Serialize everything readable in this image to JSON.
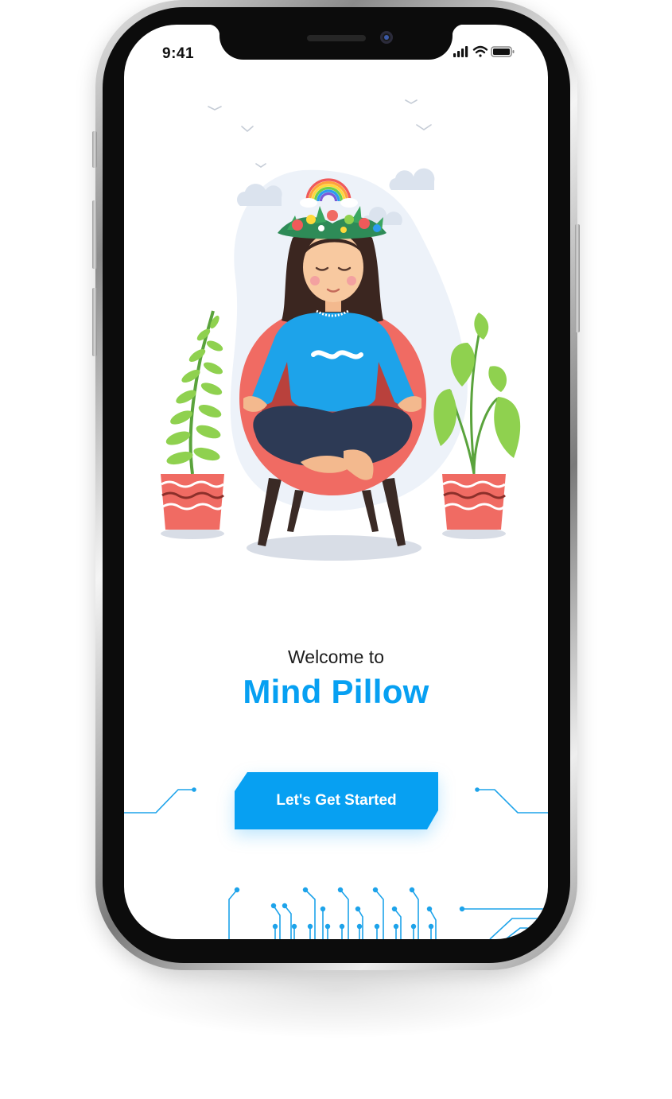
{
  "status_bar": {
    "time": "9:41"
  },
  "welcome": {
    "line1": "Welcome to",
    "app_name": "Mind Pillow"
  },
  "cta": {
    "label": "Let's Get Started"
  },
  "colors": {
    "accent": "#07a0f2",
    "background": "#ffffff",
    "text": "#1c1c1c"
  },
  "icons": [
    "cellular-signal-icon",
    "wifi-icon",
    "battery-icon",
    "meditation-illustration"
  ]
}
